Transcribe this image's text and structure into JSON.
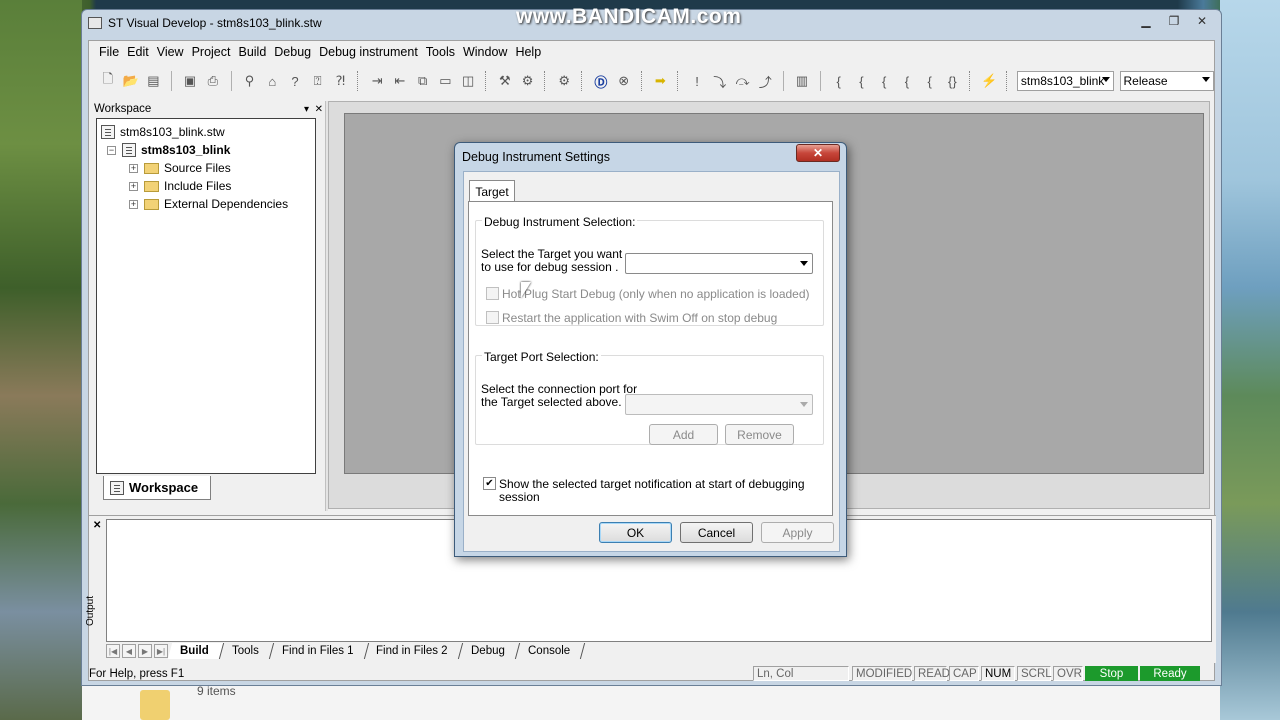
{
  "watermark": "www.BANDICAM.com",
  "window": {
    "title": "ST Visual Develop - stm8s103_blink.stw"
  },
  "menu": [
    "File",
    "Edit",
    "View",
    "Project",
    "Build",
    "Debug",
    "Debug instrument",
    "Tools",
    "Window",
    "Help"
  ],
  "toolbar": {
    "project_combo": "stm8s103_blink",
    "config_combo": "Release"
  },
  "workspace": {
    "header": "Workspace",
    "tree": {
      "root": "stm8s103_blink.stw",
      "project": "stm8s103_blink",
      "folders": [
        "Source Files",
        "Include Files",
        "External Dependencies"
      ]
    },
    "tab_label": "Workspace"
  },
  "output": {
    "side_label": "Output",
    "tabs": [
      "Build",
      "Tools",
      "Find in Files 1",
      "Find in Files 2",
      "Debug",
      "Console"
    ],
    "active_tab": "Build"
  },
  "statusbar": {
    "help": "For Help, press F1",
    "position": "Ln, Col",
    "indicators": [
      "MODIFIED",
      "READ",
      "CAP",
      "NUM",
      "SCRL",
      "OVR"
    ],
    "stop": "Stop",
    "ready": "Ready"
  },
  "background": {
    "item_count": "9 items"
  },
  "dialog": {
    "title": "Debug Instrument Settings",
    "close": "✕",
    "tab": "Target",
    "instrument_group": {
      "title": "Debug Instrument Selection:",
      "target_label_1": "Select the Target you want",
      "target_label_2": "to use for debug session .",
      "target_value": "",
      "hotplug": "Hot Plug Start Debug (only when no application is loaded)",
      "restart": "Restart the application with Swim Off on stop debug"
    },
    "port_group": {
      "title": "Target Port Selection:",
      "port_label_1": "Select the connection port for",
      "port_label_2": "the Target selected above.",
      "port_value": "",
      "add": "Add",
      "remove": "Remove"
    },
    "notify_label": "Show the selected target notification at start of debugging session",
    "notify_checked": true,
    "ok": "OK",
    "cancel": "Cancel",
    "apply": "Apply"
  }
}
